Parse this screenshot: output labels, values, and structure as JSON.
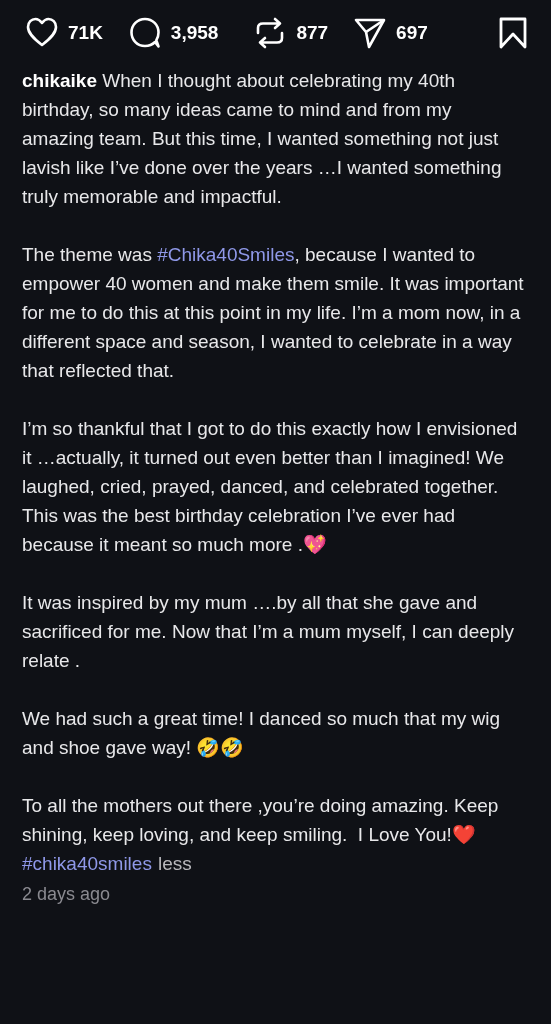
{
  "actions": [
    {
      "kind": "like",
      "count": "71K"
    },
    {
      "kind": "comment",
      "count": "3,958"
    },
    {
      "kind": "repost",
      "count": "877"
    },
    {
      "kind": "share",
      "count": "697"
    }
  ],
  "caption": [
    [
      {
        "kind": "username",
        "text": "chikaike"
      },
      {
        "kind": "plain",
        "text": " When I thought about celebrating my 40th birthday, so many ideas came to mind and from my amazing team. But this time, I wanted something not just lavish like I’ve done over the years …I wanted something truly memorable and impactful."
      }
    ],
    [
      {
        "kind": "plain",
        "text": "The theme was "
      },
      {
        "kind": "hashtag",
        "text": "#Chika40Smiles"
      },
      {
        "kind": "plain",
        "text": ", because I wanted to empower 40 women and make them smile. It was important for me to do this at this point in my life. I’m a mom now, in a different space and season, I wanted to celebrate in a way that reflected that."
      }
    ],
    [
      {
        "kind": "plain",
        "text": "I’m so thankful that I got to do this exactly how I envisioned it …actually, it turned out even better than I imagined! We laughed, cried, prayed, danced, and celebrated together. This was the best birthday celebration I’ve ever had because it meant so much more .💖"
      }
    ],
    [
      {
        "kind": "plain",
        "text": "It was inspired by my mum ….by all that she gave and sacrificed for me. Now that I’m a mum myself, I can deeply relate ."
      }
    ],
    [
      {
        "kind": "plain",
        "text": "We had such a great time! I danced so much that my wig and shoe gave way! 🤣🤣"
      }
    ],
    [
      {
        "kind": "plain",
        "text": "To all the mothers out there ,you’re doing amazing. Keep shining, keep loving, and keep smiling.  I Love You!❤️"
      }
    ]
  ],
  "tags": [
    {
      "kind": "hashtag",
      "text": "#chika40smiles"
    },
    {
      "kind": "toggle",
      "text": "less"
    }
  ],
  "time": "2 days ago"
}
